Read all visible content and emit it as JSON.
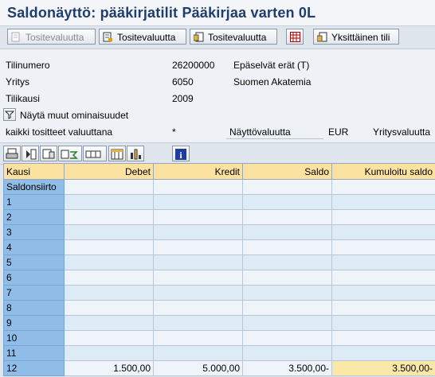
{
  "title": "Saldonäyttö: pääkirjatilit Pääkirjaa varten 0L",
  "toolbar": {
    "buttons": [
      {
        "label": "Tositevaluutta",
        "enabled": false,
        "icon": "document-icon"
      },
      {
        "label": "Tositevaluutta",
        "enabled": true,
        "icon": "document-icon"
      },
      {
        "label": "Tositevaluutta",
        "enabled": true,
        "icon": "document-list-icon"
      },
      {
        "label": "",
        "enabled": true,
        "icon": "grid-icon"
      },
      {
        "label": "Yksittäinen tili",
        "enabled": true,
        "icon": "single-account-icon"
      }
    ]
  },
  "form": {
    "tilinumero_label": "Tilinumero",
    "tilinumero_value": "26200000",
    "open_items": "Epäselvät erät (T)",
    "yritys_label": "Yritys",
    "yritys_value": "6050",
    "yritys_name": "Suomen Akatemia",
    "tilikausi_label": "Tilikausi",
    "tilikausi_value": "2009",
    "show_more_label": "Näytä muut ominaisuudet",
    "all_docs_label": "kaikki tositteet valuuttana",
    "all_docs_value": "*",
    "display_currency_label": "Näyttövaluutta",
    "display_currency_value": "EUR",
    "company_currency_label": "Yritysvaluutta"
  },
  "table": {
    "headers": {
      "kausi": "Kausi",
      "debet": "Debet",
      "kredit": "Kredit",
      "saldo": "Saldo",
      "kumuloitu": "Kumuloitu saldo"
    },
    "rows": [
      {
        "kausi": "Saldonsiirto",
        "debet": "",
        "kredit": "",
        "saldo": "",
        "kumuloitu": ""
      },
      {
        "kausi": "1",
        "debet": "",
        "kredit": "",
        "saldo": "",
        "kumuloitu": ""
      },
      {
        "kausi": "2",
        "debet": "",
        "kredit": "",
        "saldo": "",
        "kumuloitu": ""
      },
      {
        "kausi": "3",
        "debet": "",
        "kredit": "",
        "saldo": "",
        "kumuloitu": ""
      },
      {
        "kausi": "4",
        "debet": "",
        "kredit": "",
        "saldo": "",
        "kumuloitu": ""
      },
      {
        "kausi": "5",
        "debet": "",
        "kredit": "",
        "saldo": "",
        "kumuloitu": ""
      },
      {
        "kausi": "6",
        "debet": "",
        "kredit": "",
        "saldo": "",
        "kumuloitu": ""
      },
      {
        "kausi": "7",
        "debet": "",
        "kredit": "",
        "saldo": "",
        "kumuloitu": ""
      },
      {
        "kausi": "8",
        "debet": "",
        "kredit": "",
        "saldo": "",
        "kumuloitu": ""
      },
      {
        "kausi": "9",
        "debet": "",
        "kredit": "",
        "saldo": "",
        "kumuloitu": ""
      },
      {
        "kausi": "10",
        "debet": "",
        "kredit": "",
        "saldo": "",
        "kumuloitu": ""
      },
      {
        "kausi": "11",
        "debet": "",
        "kredit": "",
        "saldo": "",
        "kumuloitu": ""
      },
      {
        "kausi": "12",
        "debet": "1.500,00",
        "kredit": "5.000,00",
        "saldo": "3.500,00-",
        "kumuloitu": "3.500,00-"
      }
    ]
  },
  "colors": {
    "accent": "#1f3d6e",
    "header_bg": "#fbe2a0",
    "kausi_bg": "#8fbde8",
    "highlight": "#fbe8a8"
  }
}
